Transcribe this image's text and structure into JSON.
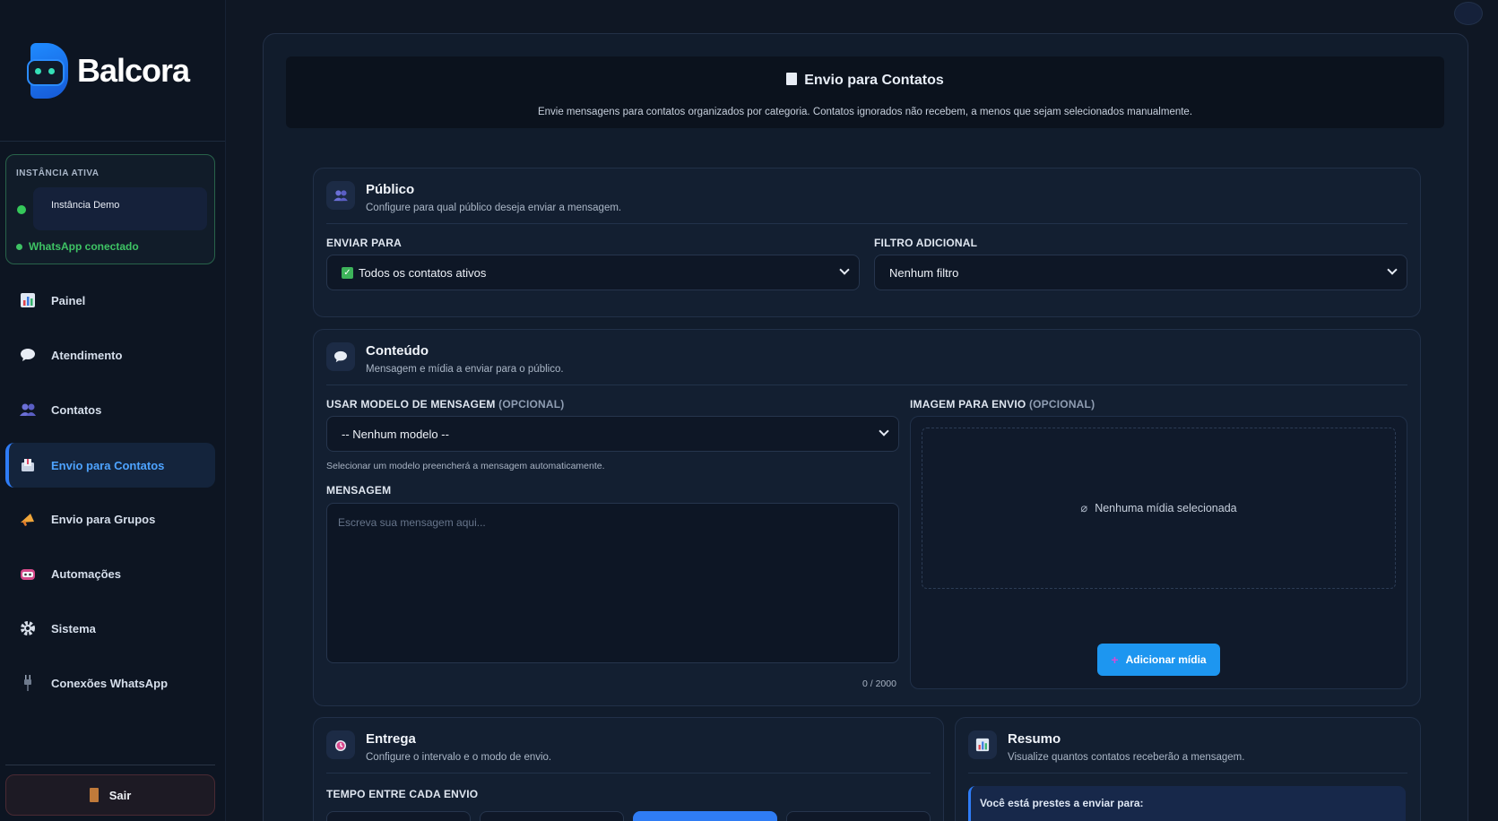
{
  "brand": {
    "name": "Balcora"
  },
  "instance": {
    "label": "INSTÂNCIA ATIVA",
    "selected": "Instância Demo",
    "status": "WhatsApp conectado"
  },
  "nav": {
    "items": [
      {
        "label": "Painel",
        "icon": "chart-icon"
      },
      {
        "label": "Atendimento",
        "icon": "chat-bubble-icon"
      },
      {
        "label": "Contatos",
        "icon": "people-icon"
      },
      {
        "label": "Envio para Contatos",
        "icon": "outbox-icon",
        "active": true
      },
      {
        "label": "Envio para Grupos",
        "icon": "megaphone-icon"
      },
      {
        "label": "Automações",
        "icon": "robot-icon"
      },
      {
        "label": "Sistema",
        "icon": "gear-icon"
      },
      {
        "label": "Conexões WhatsApp",
        "icon": "plug-icon"
      }
    ],
    "logout": "Sair"
  },
  "header": {
    "title": "Envio para Contatos",
    "subtitle": "Envie mensagens para contatos organizados por categoria. Contatos ignorados não recebem, a menos que sejam selecionados manualmente."
  },
  "publico": {
    "title": "Público",
    "description": "Configure para qual público deseja enviar a mensagem.",
    "enviar_para_label": "ENVIAR PARA",
    "enviar_para_value": "Todos os contatos ativos",
    "filtro_label": "FILTRO ADICIONAL",
    "filtro_value": "Nenhum filtro"
  },
  "conteudo": {
    "title": "Conteúdo",
    "description": "Mensagem e mídia a enviar para o público.",
    "modelo_label": "USAR MODELO DE MENSAGEM",
    "modelo_opt": "(OPCIONAL)",
    "modelo_value": "-- Nenhum modelo --",
    "modelo_helper": "Selecionar um modelo preencherá a mensagem automaticamente.",
    "mensagem_label": "MENSAGEM",
    "mensagem_placeholder": "Escreva sua mensagem aqui...",
    "counter": "0 / 2000",
    "imagem_label": "IMAGEM PARA ENVIO",
    "imagem_opt": "(OPCIONAL)",
    "no_media": "Nenhuma mídia selecionada",
    "add_media": "Adicionar mídia"
  },
  "entrega": {
    "title": "Entrega",
    "description": "Configure o intervalo e o modo de envio.",
    "tempo_label": "TEMPO ENTRE CADA ENVIO"
  },
  "resumo": {
    "title": "Resumo",
    "description": "Visualize quantos contatos receberão a mensagem.",
    "notice": "Você está prestes a enviar para:"
  },
  "colors": {
    "accent": "#2e7cf6",
    "success": "#3ec364",
    "button": "#1d96f0"
  }
}
